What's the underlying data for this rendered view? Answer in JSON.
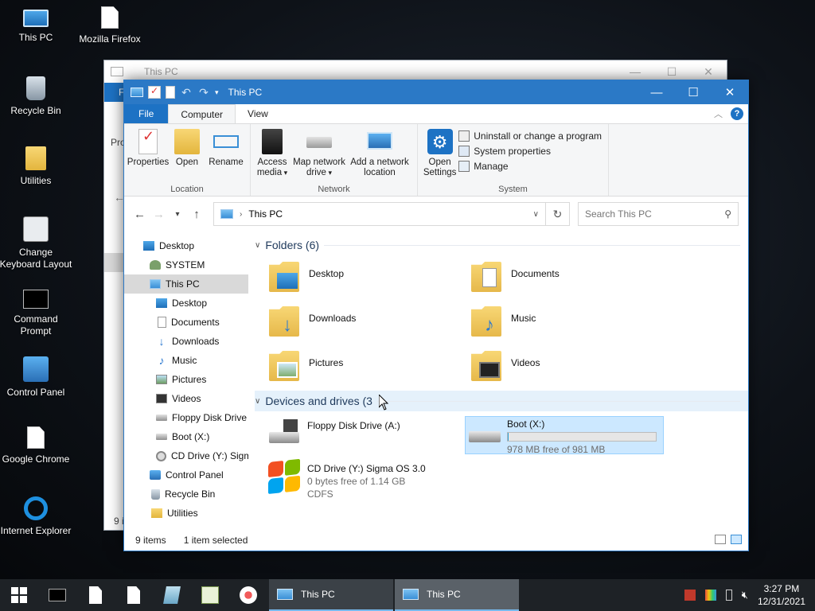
{
  "desktop": {
    "icons": [
      {
        "label": "This PC"
      },
      {
        "label": "Mozilla Firefox"
      },
      {
        "label": "Recycle Bin"
      },
      {
        "label": "Utilities"
      },
      {
        "label": "Change Keyboard Layout"
      },
      {
        "label": "Command Prompt"
      },
      {
        "label": "Control Panel"
      },
      {
        "label": "Google Chrome"
      },
      {
        "label": "Internet Explorer"
      }
    ]
  },
  "bg_window": {
    "title": "This PC",
    "partial_tab": "F",
    "partial_label": "Pro",
    "partial_status": "9 i"
  },
  "window": {
    "title": "This PC",
    "controls": {
      "minimize": "—",
      "maximize": "☐",
      "close": "✕"
    },
    "tabs": {
      "file": "File",
      "computer": "Computer",
      "view": "View"
    },
    "help": "?",
    "ribbon": {
      "location": {
        "label": "Location",
        "properties": "Properties",
        "open": "Open",
        "rename": "Rename"
      },
      "network": {
        "label": "Network",
        "access_media": "Access media",
        "map_network_drive": "Map network drive",
        "add_network_location": "Add a network location"
      },
      "system": {
        "label": "System",
        "open_settings": "Open Settings",
        "uninstall": "Uninstall or change a program",
        "system_properties": "System properties",
        "manage": "Manage"
      }
    },
    "address": {
      "path": "This PC",
      "search_placeholder": "Search This PC"
    },
    "nav": [
      {
        "label": "Desktop"
      },
      {
        "label": "SYSTEM"
      },
      {
        "label": "This PC"
      },
      {
        "label": "Desktop"
      },
      {
        "label": "Documents"
      },
      {
        "label": "Downloads"
      },
      {
        "label": "Music"
      },
      {
        "label": "Pictures"
      },
      {
        "label": "Videos"
      },
      {
        "label": "Floppy Disk Drive"
      },
      {
        "label": "Boot (X:)"
      },
      {
        "label": "CD Drive (Y:) Sigm"
      },
      {
        "label": "Control Panel"
      },
      {
        "label": "Recycle Bin"
      },
      {
        "label": "Utilities"
      }
    ],
    "folders_header": "Folders (6)",
    "folders": [
      {
        "label": "Desktop"
      },
      {
        "label": "Documents"
      },
      {
        "label": "Downloads"
      },
      {
        "label": "Music"
      },
      {
        "label": "Pictures"
      },
      {
        "label": "Videos"
      }
    ],
    "devices_header": "Devices and drives (3",
    "drives": [
      {
        "name": "Floppy Disk Drive (A:)"
      },
      {
        "name": "Boot (X:)",
        "free": "978 MB free of 981 MB",
        "used_fraction": 0.003
      },
      {
        "name": "CD Drive (Y:) Sigma OS 3.0",
        "free": "0 bytes free of 1.14 GB",
        "fs": "CDFS"
      }
    ],
    "status": {
      "items": "9 items",
      "selected": "1 item selected"
    }
  },
  "taskbar": {
    "tasks": [
      {
        "label": "This PC"
      },
      {
        "label": "This PC"
      }
    ],
    "clock": {
      "time": "3:27 PM",
      "date": "12/31/2021"
    }
  }
}
